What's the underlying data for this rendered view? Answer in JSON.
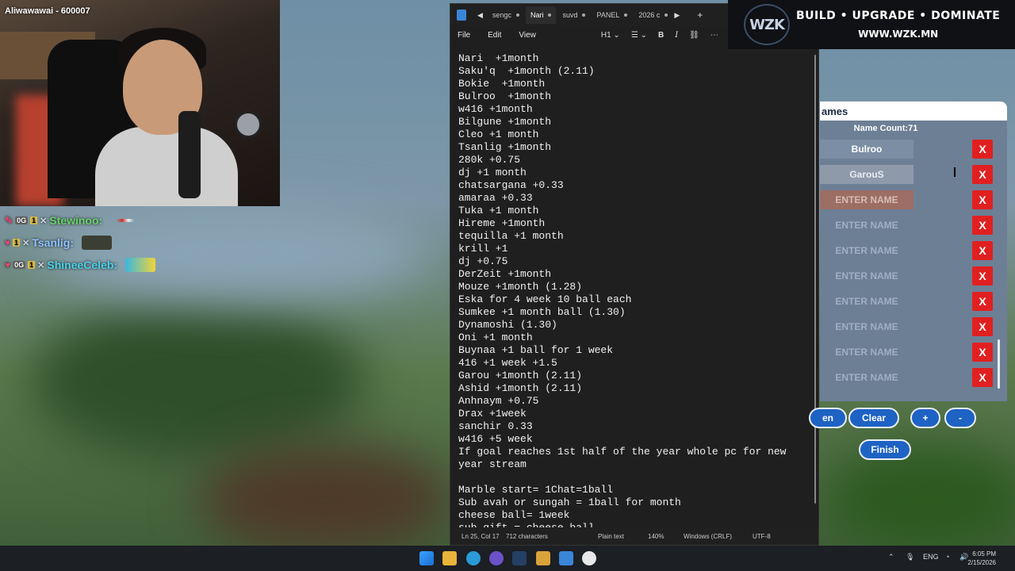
{
  "stream": {
    "cam_overlay": "Aliwawawai - 600007"
  },
  "chat": [
    {
      "user": "Stewinoo:",
      "color": "#6bd16b",
      "badge": "0G",
      "sub": "1"
    },
    {
      "user": "Tsanlig:",
      "color": "#8fc0ff",
      "badge": "1"
    },
    {
      "user": "ShineeCeleb:",
      "color": "#4bd0e8",
      "badge": "0G",
      "sub": "1"
    }
  ],
  "notepad": {
    "tabs": [
      "sengc",
      "Nari",
      "suvd",
      "PANEL",
      "2026 c"
    ],
    "menu": [
      "File",
      "Edit",
      "View"
    ],
    "format": {
      "heading": "H1",
      "bold": "B",
      "italic": "I"
    },
    "lines": [
      "Nari  +1month",
      "Saku'q  +1month (2.11)",
      "Bokie  +1month",
      "Bulroo  +1month",
      "w416 +1month",
      "Bilgune +1month",
      "Cleo +1 month",
      "Tsanlig +1month",
      "280k +0.75",
      "dj +1 month",
      "chatsargana +0.33",
      "amaraa +0.33",
      "Tuka +1 month",
      "Hireme +1month",
      "tequilla +1 month",
      "krill +1",
      "dj +0.75",
      "DerZeit +1month",
      "Mouze +1month (1.28)",
      "Eska for 4 week 10 ball each",
      "Sumkee +1 month ball (1.30)",
      "Dynamoshi (1.30)",
      "Oni +1 month",
      "Buynaa +1 ball for 1 week",
      "416 +1 week +1.5",
      "Garou +1month (2.11)",
      "Ashid +1month (2.11)",
      "Anhnaym +0.75",
      "Drax +1week",
      "sanchir 0.33",
      "w416 +5 week",
      "If goal reaches 1st half of the year whole pc for new",
      "year stream",
      "",
      "Marble start= 1Chat=1ball",
      "Sub avah or sungah = 1ball for month",
      "cheese ball= 1week",
      "sub gift = cheese ball"
    ],
    "status": {
      "position": "Ln 25, Col 17",
      "chars": "712 characters",
      "mode": "Plain text",
      "zoom": "140%",
      "line_ending": "Windows (CRLF)",
      "encoding": "UTF-8"
    }
  },
  "banner": {
    "logo": "WZK",
    "title": "BUILD • UPGRADE • DOMINATE",
    "url": "WWW.WZK.MN"
  },
  "names_panel": {
    "title": "ames",
    "count_label": "Name Count:71",
    "rows": [
      {
        "value": "Bulroo",
        "placeholder": "",
        "style": "filled"
      },
      {
        "value": "GarouS",
        "placeholder": "",
        "style": "grey"
      },
      {
        "value": "",
        "placeholder": "ENTER NAME",
        "style": "red"
      },
      {
        "value": "",
        "placeholder": "ENTER NAME",
        "style": "empty"
      },
      {
        "value": "",
        "placeholder": "ENTER NAME",
        "style": "empty"
      },
      {
        "value": "",
        "placeholder": "ENTER NAME",
        "style": "empty"
      },
      {
        "value": "",
        "placeholder": "ENTER NAME",
        "style": "empty"
      },
      {
        "value": "",
        "placeholder": "ENTER NAME",
        "style": "empty"
      },
      {
        "value": "",
        "placeholder": "ENTER NAME",
        "style": "empty"
      },
      {
        "value": "",
        "placeholder": "ENTER NAME",
        "style": "empty"
      }
    ],
    "remove_label": "X",
    "buttons": {
      "open": "en",
      "clear": "Clear",
      "plus": "+",
      "minus": "-",
      "finish": "Finish"
    }
  },
  "taskbar": {
    "lang": "ENG",
    "time": "6:05 PM",
    "date": "2/15/2026"
  }
}
